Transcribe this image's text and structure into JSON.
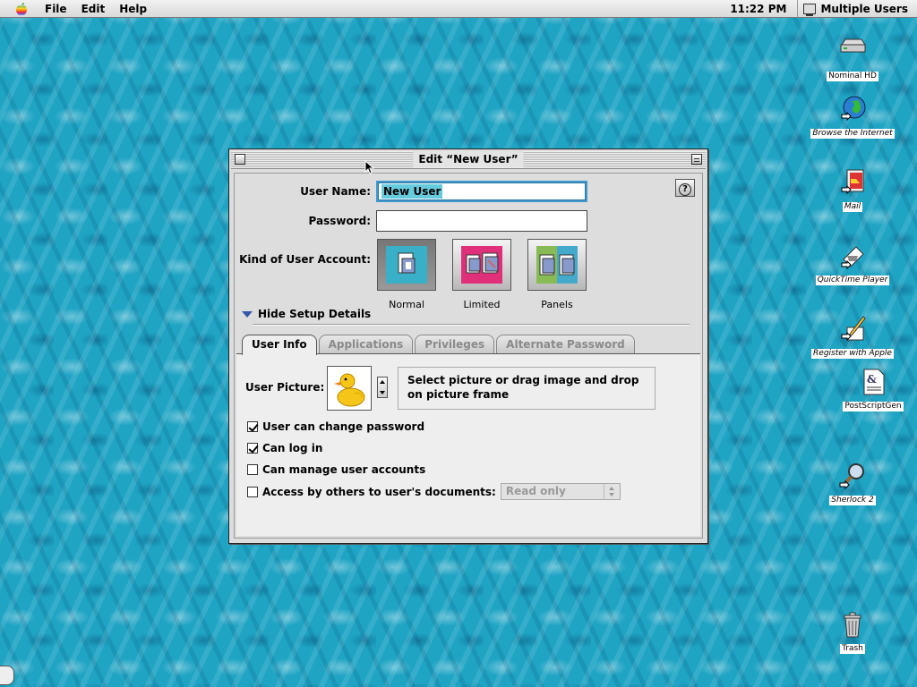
{
  "menubar": {
    "items": [
      "File",
      "Edit",
      "Help"
    ],
    "clock": "11:22 PM",
    "app_name": "Multiple Users"
  },
  "desktop": {
    "icons": [
      {
        "label": "Nominal HD",
        "icon": "hard-drive-icon"
      },
      {
        "label": "Browse the Internet",
        "icon": "globe-icon"
      },
      {
        "label": "Mail",
        "icon": "mail-icon"
      },
      {
        "label": "QuickTime Player",
        "icon": "quicktime-icon"
      },
      {
        "label": "Register with Apple",
        "icon": "register-icon"
      },
      {
        "label": "PostScriptGen",
        "icon": "document-icon"
      },
      {
        "label": "Sherlock 2",
        "icon": "magnifier-icon"
      },
      {
        "label": "Trash",
        "icon": "trash-icon"
      }
    ]
  },
  "window": {
    "title": "Edit “New User”",
    "user_name_label": "User Name:",
    "user_name_value": "New User",
    "password_label": "Password:",
    "password_value": "",
    "kind_label": "Kind of User Account:",
    "kinds": [
      {
        "label": "Normal",
        "selected": true
      },
      {
        "label": "Limited",
        "selected": false
      },
      {
        "label": "Panels",
        "selected": false
      }
    ],
    "disclosure_label": "Hide Setup Details",
    "tabs": [
      {
        "label": "User Info",
        "active": true
      },
      {
        "label": "Applications",
        "active": false
      },
      {
        "label": "Privileges",
        "active": false
      },
      {
        "label": "Alternate Password",
        "active": false
      }
    ],
    "user_picture_label": "User Picture:",
    "picture_hint": "Select picture or drag image and drop on picture frame",
    "options": [
      {
        "label": "User can change password",
        "checked": true
      },
      {
        "label": "Can log in",
        "checked": true
      },
      {
        "label": "Can manage user accounts",
        "checked": false
      },
      {
        "label": "Access by others to user's documents:",
        "checked": false
      }
    ],
    "access_popup_value": "Read only"
  }
}
